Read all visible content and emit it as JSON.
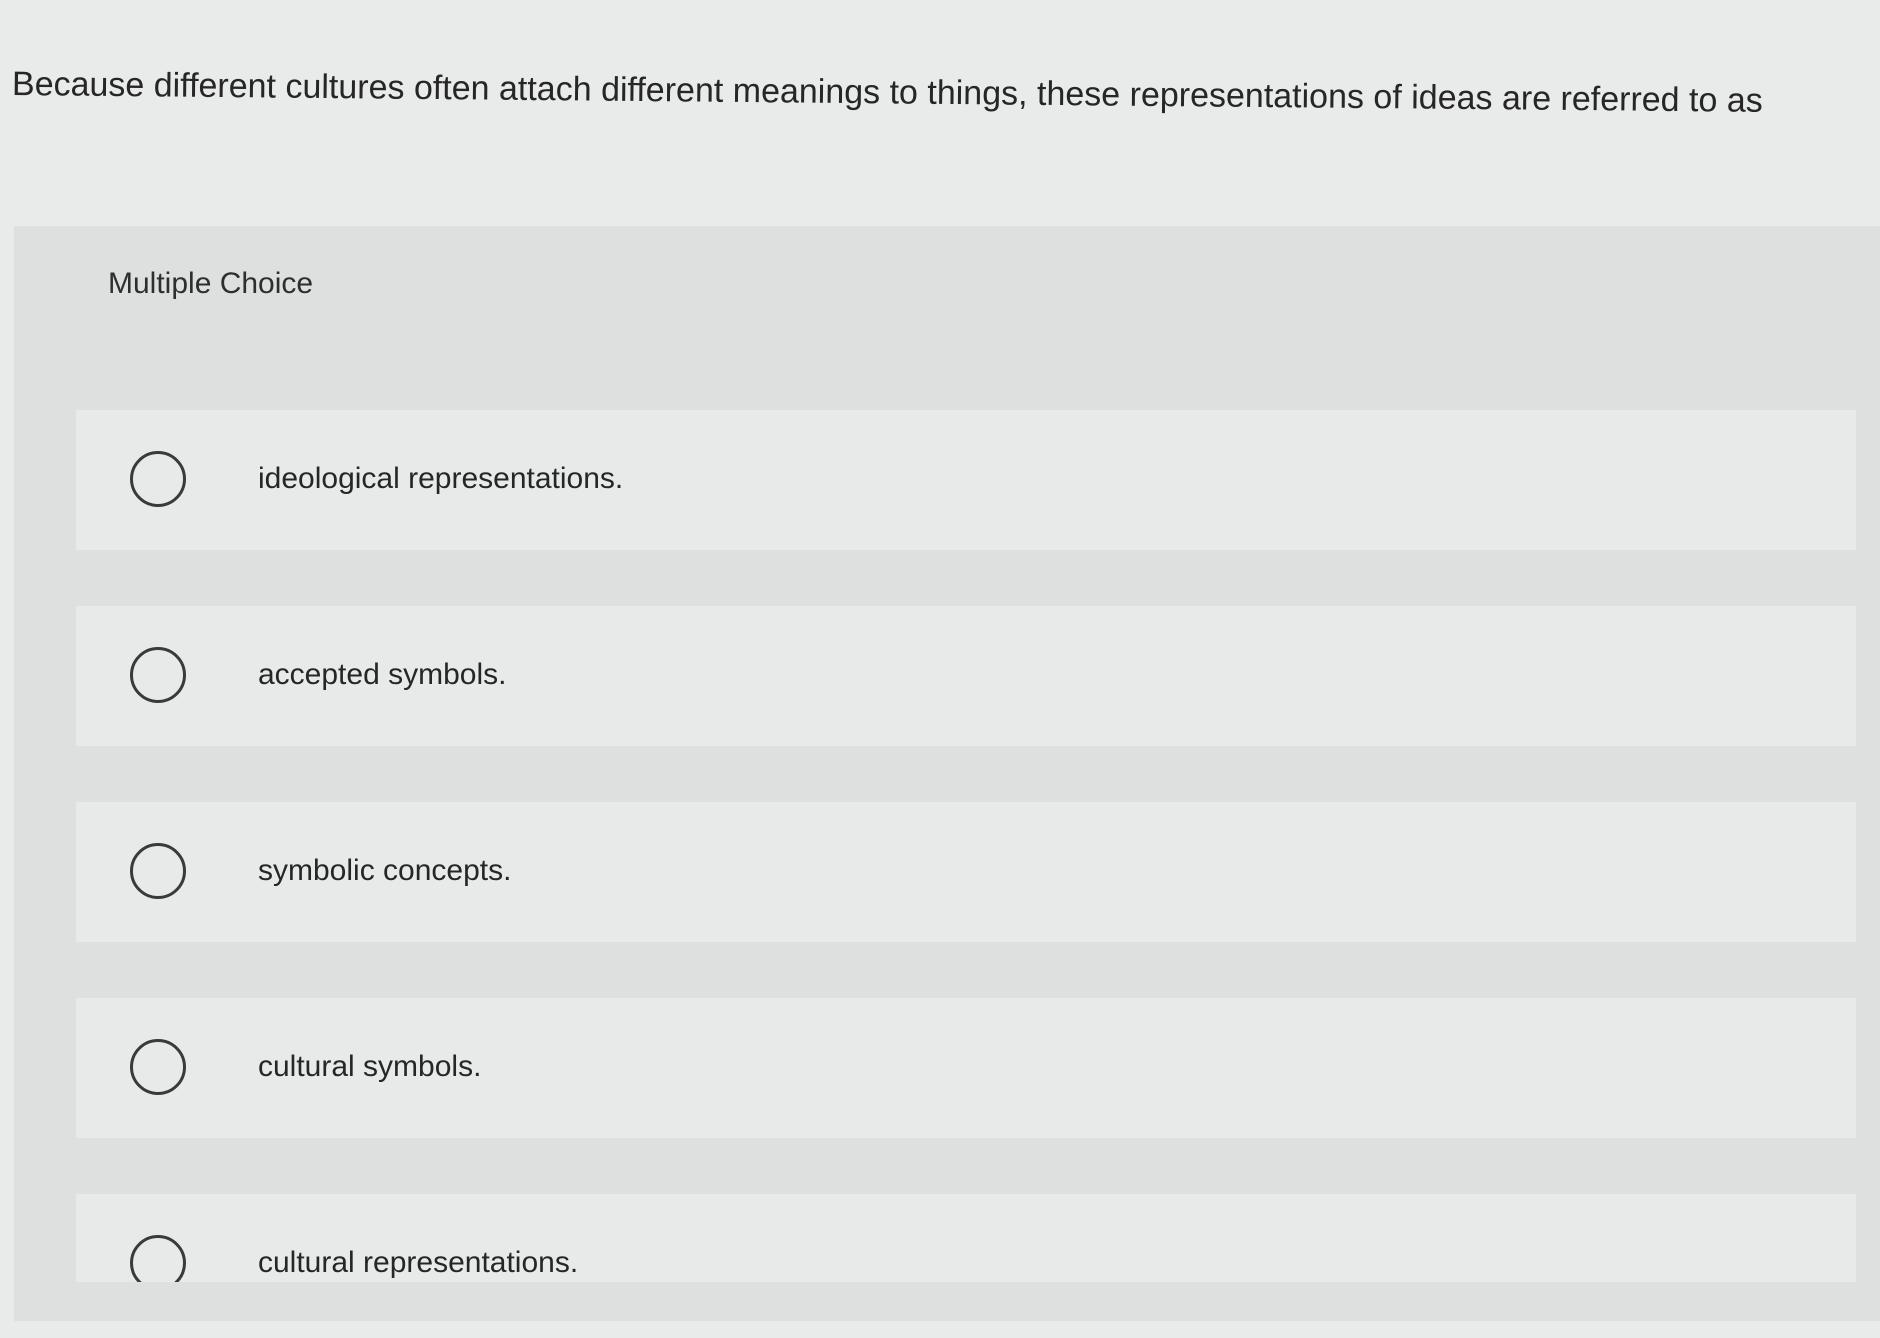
{
  "question": {
    "text": "Because different cultures often attach different meanings to things, these representations of ideas are referred to as"
  },
  "quiz": {
    "type_label": "Multiple Choice",
    "options": [
      {
        "label": "ideological representations."
      },
      {
        "label": "accepted symbols."
      },
      {
        "label": "symbolic concepts."
      },
      {
        "label": "cultural symbols."
      },
      {
        "label": "cultural representations."
      }
    ]
  },
  "icons": {
    "radio": "radio-button-unselected-icon"
  },
  "colors": {
    "background": "#e9eaea",
    "panel": "#dedfdf",
    "option_row": "#e8e9e9",
    "text": "#262626"
  }
}
